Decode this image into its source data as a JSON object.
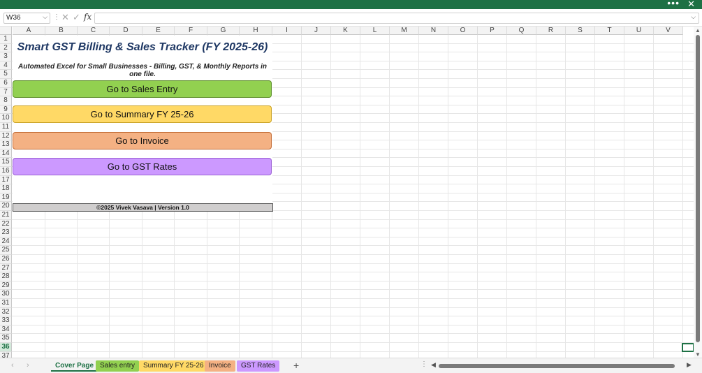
{
  "titlebar": {
    "more_label": "•••",
    "close_label": "✕"
  },
  "formula_bar": {
    "name_box": "W36",
    "formula": "",
    "fx_label": "fx"
  },
  "columns": [
    "A",
    "B",
    "C",
    "D",
    "E",
    "F",
    "G",
    "H",
    "I",
    "J",
    "K",
    "L",
    "M",
    "N",
    "O",
    "P",
    "Q",
    "R",
    "S",
    "T",
    "U",
    "V"
  ],
  "rows": [
    "1",
    "2",
    "3",
    "4",
    "5",
    "6",
    "7",
    "8",
    "9",
    "10",
    "11",
    "12",
    "13",
    "14",
    "15",
    "16",
    "17",
    "18",
    "19",
    "20",
    "21",
    "22",
    "23",
    "24",
    "25",
    "26",
    "27",
    "28",
    "29",
    "30",
    "31",
    "32",
    "33",
    "34",
    "35",
    "36",
    "37"
  ],
  "selected_row": "36",
  "sheet": {
    "title": "Smart GST Billing & Sales Tracker (FY 2025-26)",
    "subtitle": "Automated Excel for Small Businesses - Billing, GST, & Monthly Reports in one file.",
    "buttons": {
      "sales": "Go to Sales Entry",
      "summary": "Go to Summary FY 25-26",
      "invoice": "Go to Invoice",
      "gst": "Go to GST Rates"
    },
    "footer": "©2025 Vivek Vasava | Version 1.0"
  },
  "tabs": {
    "cover": "Cover Page",
    "sales": "Sales entry",
    "summary": "Summary FY 25-26",
    "invoice": "Invoice",
    "gst": "GST Rates",
    "add": "+"
  },
  "colors": {
    "excel_green": "#1e7145",
    "title_blue": "#1f3864",
    "sales_green": "#92d050",
    "summary_yellow": "#ffd966",
    "invoice_orange": "#f4b183",
    "gst_purple": "#cc99ff",
    "footer_gray": "#d0cece"
  }
}
